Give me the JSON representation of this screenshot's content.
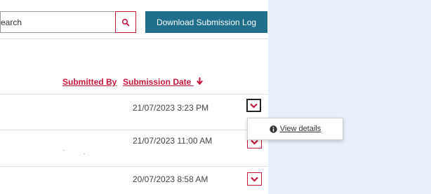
{
  "toolbar": {
    "search_value": "earch",
    "download_label": "Download Submission Log"
  },
  "table": {
    "headers": {
      "submitted_by": "Submitted By",
      "submission_date": "Submission Date"
    },
    "sort_arrow": "🡣",
    "rows": [
      {
        "date": "21/07/2023 3:23 PM"
      },
      {
        "date": "21/07/2023 11:00 AM"
      },
      {
        "date": "20/07/2023 8:58 AM"
      }
    ]
  },
  "popup": {
    "view_details_label": "View details"
  },
  "colors": {
    "accent": "#c5153c",
    "primary_button": "#1f6e8c",
    "background": "#d6e6f7"
  },
  "icons": {
    "search": "search-icon",
    "chevron": "chevron-down-icon",
    "info": "info-circle-icon"
  }
}
